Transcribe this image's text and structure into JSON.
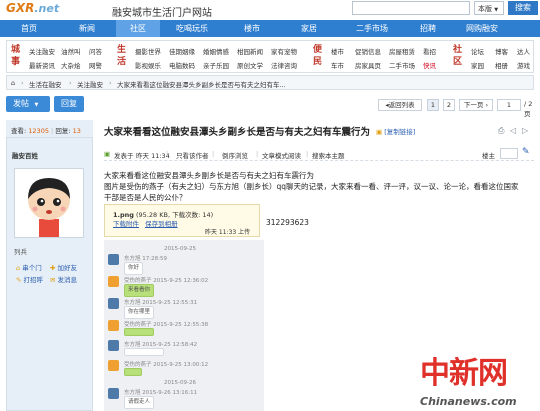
{
  "header": {
    "logo_prefix": "GXR",
    "logo_suffix": ".net",
    "site_title": "融安城市生活门户网站",
    "search_placeholder": "",
    "search_scope": "本版",
    "search_button": "搜索"
  },
  "nav": {
    "items": [
      {
        "label": "首页",
        "active": false
      },
      {
        "label": "新闻",
        "active": false
      },
      {
        "label": "社区",
        "active": true
      },
      {
        "label": "吃喝玩乐",
        "active": false
      },
      {
        "label": "楼市",
        "active": false
      },
      {
        "label": "家居",
        "active": false
      },
      {
        "label": "二手市场",
        "active": false
      },
      {
        "label": "招聘",
        "active": false
      },
      {
        "label": "网购融安",
        "active": false
      }
    ]
  },
  "categories": {
    "group1": {
      "heading": "城事",
      "row1": [
        "关注融安",
        "油然叫",
        "问答"
      ],
      "row2": [
        "最新资讯",
        "大杂烩",
        "网警"
      ]
    },
    "group2": {
      "heading": "生活",
      "row1": [
        "摄影世界",
        "佳期姻缘",
        "婚姻情感",
        "柑园新闻",
        "家有宠物"
      ],
      "row2": [
        "影视娱乐",
        "电脑数码",
        "亲子乐园",
        "原创文学",
        "法律咨询"
      ]
    },
    "group3": {
      "heading": "便民",
      "row1": [
        "楼市",
        "促销信息",
        "房屋租赁",
        "看招"
      ],
      "row2": [
        "车市",
        "房家具页",
        "二手市场",
        "快讯"
      ]
    },
    "group4": {
      "heading": "社区",
      "row1": [
        "论坛",
        "博客",
        "达人"
      ],
      "row2": [
        "家园",
        "相册",
        "游戏"
      ]
    }
  },
  "breadcrumb": {
    "items": [
      "生活在融安",
      "关注融安",
      "大家来看看这位融安县潭头乡副乡长是否与有夫之妇有车..."
    ]
  },
  "toolbar": {
    "post_label": "发帖",
    "reply_label": "回复",
    "prev_page": "返回列表",
    "pages": [
      "1",
      "2"
    ],
    "next_page": "下一页",
    "page_input": "1",
    "page_total": "/ 2 页"
  },
  "author": {
    "stats_label": "查看:",
    "views": "12305",
    "replies_label": "回复:",
    "replies": "13",
    "name": "融安百姓",
    "level": "列兵",
    "actions": [
      "串个门",
      "加好友",
      "打招呼",
      "发消息"
    ]
  },
  "post": {
    "title": "大家来看看这位融安县潭头乡副乡长是否与有夫之妇有车震行为",
    "copy_link": "[复制链接]",
    "posted_label": "发表于",
    "posted_time": "昨天 11:34",
    "meta_links": [
      "只看该作者",
      "倒序浏览",
      "文章模式阅读",
      "搜索本主题"
    ],
    "floor_label": "楼主",
    "body_lines": [
      "大家来看看这位融安县潭头乡副乡长是否与有夫之妇有车震行为",
      "图片是受伤的燕子（有夫之妇）与东方旭（副乡长）qq聊天的记录，大家来看一看、评一评，议一议、论一论，看看这位国家",
      "干部是否是人民的公仆？"
    ],
    "attachment": {
      "file": "1.png",
      "info": "(95.28 KB, 下载次数: 14)",
      "links": [
        "下载附件",
        "保存到相册"
      ],
      "time": "昨天 11:33 上传"
    },
    "qq_number": "312293623"
  },
  "chat": {
    "messages": [
      {
        "time": "2015-09-25",
        "text": "",
        "side": "l"
      },
      {
        "time": "东方旭 17:28:59",
        "text": "你好",
        "side": "l"
      },
      {
        "time": "受伤的燕子 2015-9-25 12:36:02",
        "text": "来看看你",
        "side": "r"
      },
      {
        "time": "东方旭 2015-9-25 12:55:31",
        "text": "你在哪里",
        "side": "l"
      },
      {
        "time": "受伤的燕子 2015-9-25 12:55:38",
        "text": "",
        "side": "r"
      },
      {
        "time": "东方旭 2015-9-25 12:58:42",
        "text": "",
        "side": "l"
      },
      {
        "time": "受伤的燕子 2015-9-25 13:00:12",
        "text": "",
        "side": "r"
      },
      {
        "time": "2015-09-26",
        "text": "",
        "side": "l"
      },
      {
        "time": "东方旭 2015-9-26 13:16:11",
        "text": "请假走人",
        "side": "l"
      }
    ]
  },
  "watermark": {
    "mark": "中新网",
    "url": "Chinanews.com"
  }
}
